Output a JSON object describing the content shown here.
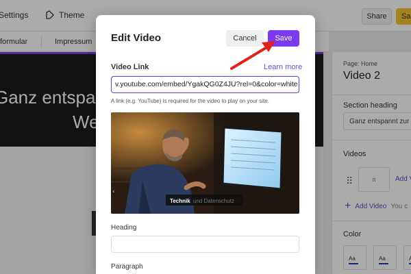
{
  "topbar": {
    "settings_label": "Settings",
    "theme_label": "Theme",
    "share_label": "Share",
    "save_label": "Sa"
  },
  "subnav": {
    "item1": "formular",
    "item2": "Impressum"
  },
  "preview": {
    "hero_line1": "Ganz entspan",
    "hero_line2": "We"
  },
  "right_panel": {
    "page_label": "Page: Home",
    "title": "Video 2",
    "section_heading_label": "Section heading",
    "section_heading_value": "Ganz entspannt zur",
    "videos_label": "Videos",
    "video_thumb_text": "π",
    "add_video_short": "Add V",
    "add_video_label": "Add Video",
    "add_video_suffix": "You c",
    "color_label": "Color",
    "swatch_label": "Aa"
  },
  "modal": {
    "title": "Edit Video",
    "cancel_label": "Cancel",
    "save_label": "Save",
    "video_link_label": "Video Link",
    "learn_more_label": "Learn more",
    "video_link_value": "v.youtube.com/embed/YgakQG0Z4JU?rel=0&color=white",
    "help_text": "A link (e.g. YouTube) is required for the video to play on your site.",
    "video_caption_strong": "Technik",
    "video_caption_faint": "und Datenschutz",
    "heading_label": "Heading",
    "paragraph_label": "Paragraph"
  },
  "colors": {
    "accent": "#7c3aed",
    "arrow": "#e0201b",
    "top_save": "#f2c230"
  }
}
